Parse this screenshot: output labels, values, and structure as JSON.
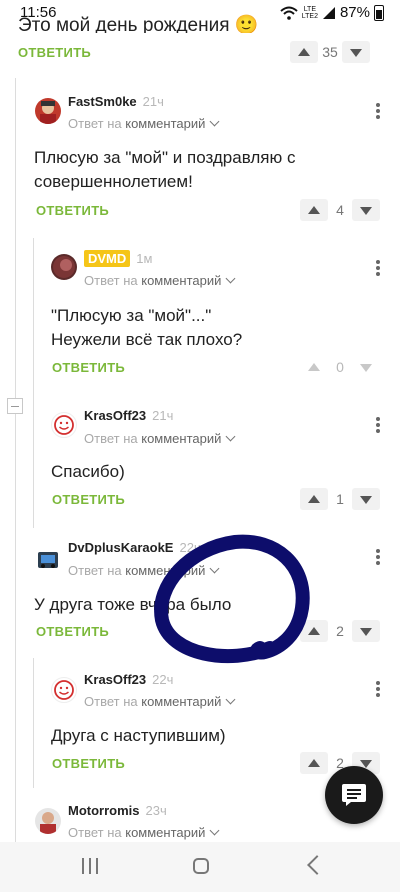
{
  "status_bar": {
    "time": "11:56",
    "battery": "87%",
    "lte": "LTE",
    "lte2": "LTE2"
  },
  "partial_top": {
    "text": "Это мой день рождения 🙂",
    "reply": "ОТВЕТИТЬ",
    "votes": "35"
  },
  "labels": {
    "reply": "ОТВЕТИТЬ",
    "reply_to_prefix": "Ответ на",
    "reply_to_target": "комментарий"
  },
  "comments": [
    {
      "author": "FastSm0ke",
      "time": "21ч",
      "lines": [
        "Плюсую за \"мой\" и поздравляю с",
        "совершеннолетием!"
      ],
      "votes": "4"
    },
    {
      "author": "DVMD",
      "time": "1м",
      "lines": [
        "\"Плюсую за \"мой\"...\"",
        "Неужели всё так плохо?"
      ],
      "votes": "0"
    },
    {
      "author": "KrasOff23",
      "time": "21ч",
      "lines": [
        "Спасибо)"
      ],
      "votes": "1"
    },
    {
      "author": "DvDplusKaraokE",
      "time": "22ч",
      "lines": [
        "У друга тоже вчера было"
      ],
      "votes": "2"
    },
    {
      "author": "KrasOff23",
      "time": "22ч",
      "lines": [
        "Друга с наступившим)"
      ],
      "votes": "2"
    },
    {
      "author": "Motorromis",
      "time": "23ч",
      "lines": [],
      "votes": ""
    }
  ],
  "icons": {
    "fab": "chat-bubble-icon",
    "nav_recent": "recent-apps-icon",
    "nav_home": "home-icon",
    "nav_back": "back-icon"
  },
  "colors": {
    "reply_green": "#7bb83a",
    "badge_yellow": "#f5c518",
    "scribble": "#0d0d6b"
  }
}
